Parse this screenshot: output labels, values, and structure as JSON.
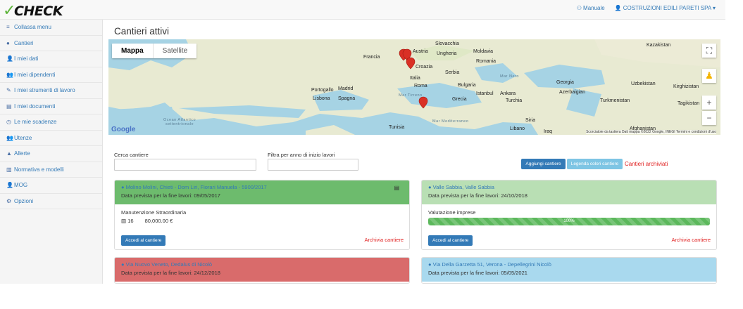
{
  "app": {
    "logo": "CHECK",
    "manual_label": "Manuale",
    "user_label": "COSTRUZIONI EDILI PARETI SPA"
  },
  "sidebar": {
    "items": [
      {
        "label": "Collassa menu",
        "icon": "bars-icon",
        "glyph": "≡"
      },
      {
        "label": "Cantieri",
        "icon": "map-marker-icon",
        "glyph": "●"
      },
      {
        "label": "I miei dati",
        "icon": "user-icon",
        "glyph": "👤"
      },
      {
        "label": "I miei dipendenti",
        "icon": "users-icon",
        "glyph": "👥"
      },
      {
        "label": "I miei strumenti di lavoro",
        "icon": "wrench-icon",
        "glyph": "✎"
      },
      {
        "label": "I miei documenti",
        "icon": "file-icon",
        "glyph": "▤"
      },
      {
        "label": "Le mie scadenze",
        "icon": "clock-icon",
        "glyph": "◷"
      },
      {
        "label": "Utenze",
        "icon": "users-icon",
        "glyph": "👥"
      },
      {
        "label": "Allerte",
        "icon": "bell-icon",
        "glyph": "▲"
      },
      {
        "label": "Normativa e modelli",
        "icon": "book-icon",
        "glyph": "▥"
      },
      {
        "label": "MOG",
        "icon": "user-red-icon",
        "glyph": "👤"
      },
      {
        "label": "Opzioni",
        "icon": "gear-icon",
        "glyph": "⚙"
      }
    ]
  },
  "page": {
    "title": "Cantieri attivi"
  },
  "map": {
    "tab_map": "Mappa",
    "tab_satellite": "Satellite",
    "google": "Google",
    "footer": "Scorciatoie da tastiera   Dati mappa ©2022 Google, INEGI   Termini e condizioni d'uso",
    "labels": [
      {
        "text": "Slovacchia"
      },
      {
        "text": "Austria"
      },
      {
        "text": "Ungheria"
      },
      {
        "text": "Moldavia"
      },
      {
        "text": "Francia"
      },
      {
        "text": "Croazia"
      },
      {
        "text": "Romania"
      },
      {
        "text": "Serbia"
      },
      {
        "text": "Italia"
      },
      {
        "text": "Roma"
      },
      {
        "text": "Bulgaria"
      },
      {
        "text": "Portogallo"
      },
      {
        "text": "Madrid"
      },
      {
        "text": "Spagna"
      },
      {
        "text": "Lisbona"
      },
      {
        "text": "Mar Tirreno"
      },
      {
        "text": "Grecia"
      },
      {
        "text": "Istanbul"
      },
      {
        "text": "Ankara"
      },
      {
        "text": "Turchia"
      },
      {
        "text": "Mar Nero"
      },
      {
        "text": "Georgia"
      },
      {
        "text": "Azerbaigian"
      },
      {
        "text": "Turkmenistan"
      },
      {
        "text": "Kazakistan"
      },
      {
        "text": "Uzbekistan"
      },
      {
        "text": "Kirghizistan"
      },
      {
        "text": "Tagikistan"
      },
      {
        "text": "Afghanistan"
      },
      {
        "text": "Siria"
      },
      {
        "text": "Libano"
      },
      {
        "text": "Iraq"
      },
      {
        "text": "Tunisia"
      },
      {
        "text": "Mar Mediterraneo"
      },
      {
        "text": "Ocean Atlantico settentrionale"
      }
    ]
  },
  "filters": {
    "search_label": "Cerca cantiere",
    "year_label": "Filtra per anno di inizio lavori",
    "add_button": "Aggiungi cantiere",
    "legend_button": "Legenda colori cantiere",
    "archived_link": "Cantieri archiviati"
  },
  "cards": [
    {
      "address": "Molino Molini, Chieti - Dom Liri, Fiorari Manuela - 5900/2017",
      "date": "Data prevista per la fine lavori: 09/05/2017",
      "header_color": "#6dbb6d",
      "body_title": "Manutenzione Straordinaria",
      "workers": "16",
      "amount": "80,000.00 €",
      "access": "Accedi al cantiere",
      "archive": "Archivia cantiere"
    },
    {
      "address": "Valle Sabbia, Valle Sabbia",
      "date": "Data prevista per la fine lavori: 24/10/2018",
      "header_color": "#b9dfb4",
      "body_title": "Valutazione imprese",
      "progress": 100,
      "progress_label": "100%",
      "access": "Accedi al cantiere",
      "archive": "Archivia cantiere"
    },
    {
      "address": "Via Nuovo Veneto, Dedalus di Nicolò",
      "date": "Data prevista per la fine lavori: 24/12/2018",
      "header_color": "#d96b6b"
    },
    {
      "address": "Via Della Garzetta 51, Verona - Depellegrini Nicolò",
      "date": "Data prevista per la fine lavori: 05/05/2021",
      "header_color": "#a9d9ee"
    }
  ]
}
